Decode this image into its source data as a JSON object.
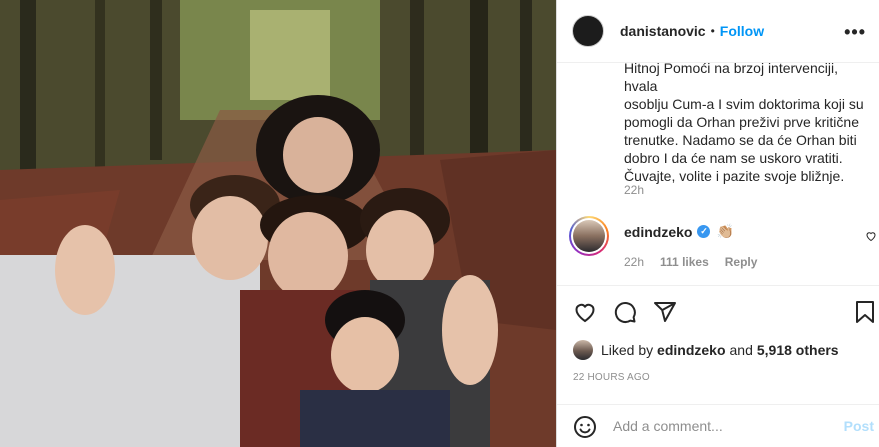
{
  "post": {
    "username": "danistanovic",
    "separator": "•",
    "follow_label": "Follow",
    "more_label": "•••",
    "caption": "Hitnoj Pomoći na brzoj intervenciji, hvala\nosoblju Cum-a I svim doktorima koji su\npomogli da Orhan preživi prve kritične\ntrenutke. Nadamo se da će Orhan biti\ndobro I da će nam se uskoro vratiti.\nČuvajte, volite i pazite svoje bližnje.",
    "caption_time": "22h"
  },
  "comment": {
    "username": "edindzeko",
    "verified_mark": "✓",
    "text": "👏🏼",
    "time": "22h",
    "likes": "111 likes",
    "reply_label": "Reply"
  },
  "likes": {
    "liked_by_label": "Liked by",
    "liker": "edindzeko",
    "and_label": "and",
    "others": "5,918 others"
  },
  "timestamp": "22 HOURS AGO",
  "add_comment": {
    "placeholder": "Add a comment...",
    "post_label": "Post"
  },
  "icons": {
    "heart": "heart-icon",
    "comment": "comment-icon",
    "share": "share-icon",
    "save": "bookmark-icon",
    "emoji": "emoji-icon",
    "more": "more-icon"
  },
  "colors": {
    "link_blue": "#0095f6",
    "post_disabled": "#b2dffc",
    "verified": "#3897f0",
    "muted": "#8e8e8e"
  }
}
